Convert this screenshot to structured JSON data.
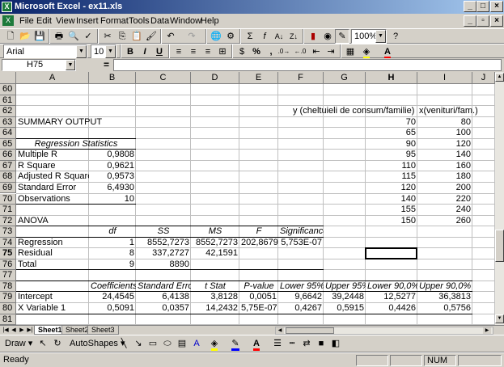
{
  "window": {
    "title": "Microsoft Excel - ex11.xls",
    "app_icon": "X",
    "min_btn": "_",
    "max_btn": "□",
    "close_btn": "×"
  },
  "menu": {
    "items": [
      "File",
      "Edit",
      "View",
      "Insert",
      "Format",
      "Tools",
      "Data",
      "Window",
      "Help"
    ],
    "doc_min": "_",
    "doc_restore": "▫",
    "doc_close": "×"
  },
  "toolbar_standard": {
    "zoom": "100%"
  },
  "toolbar_format": {
    "font": "Arial",
    "size": "10",
    "bold": "B",
    "italic": "I",
    "underline": "U",
    "percent": "%",
    "comma": ","
  },
  "formula_bar": {
    "name_box": "H75",
    "equals": "=",
    "content": ""
  },
  "columns": [
    "A",
    "B",
    "C",
    "D",
    "E",
    "F",
    "G",
    "H",
    "I",
    "J"
  ],
  "active_column": "H",
  "rows": [
    "60",
    "61",
    "62",
    "63",
    "64",
    "65",
    "66",
    "67",
    "68",
    "69",
    "70",
    "71",
    "72",
    "73",
    "74",
    "75",
    "76",
    "77",
    "78",
    "79",
    "80",
    "81"
  ],
  "active_row": "75",
  "cells": {
    "F62": "y (cheltuieli de consum/familie)",
    "I62": "x(venituri/fam.)",
    "A63": "SUMMARY OUTPUT",
    "B65": "Regression Statistics",
    "A66": "Multiple R",
    "B66": "0,9808",
    "A67": "R Square",
    "B67": "0,9621",
    "A68": "Adjusted R Square",
    "B68": "0,9573",
    "A69": "Standard Error",
    "B69": "6,4930",
    "A70": "Observations",
    "B70": "10",
    "A72": "ANOVA",
    "B73": "df",
    "C73": "SS",
    "D73": "MS",
    "E73": "F",
    "F73": "Significance F",
    "A74": "Regression",
    "B74": "1",
    "C74": "8552,7273",
    "D74": "8552,7273",
    "E74": "202,8679",
    "F74": "5,753E-07",
    "A75": "Residual",
    "B75": "8",
    "C75": "337,2727",
    "D75": "42,1591",
    "A76": "Total",
    "B76": "9",
    "C76": "8890",
    "B78": "Coefficients",
    "C78": "Standard Error",
    "D78": "t Stat",
    "E78": "P-value",
    "F78": "Lower 95%",
    "G78": "Upper 95%",
    "H78": "Lower 90,0%",
    "I78": "Upper 90,0%",
    "A79": "Intercept",
    "B79": "24,4545",
    "C79": "6,4138",
    "D79": "3,8128",
    "E79": "0,0051",
    "F79": "9,6642",
    "G79": "39,2448",
    "H79": "12,5277",
    "I79": "36,3813",
    "A80": "X Variable 1",
    "B80": "0,5091",
    "C80": "0,0357",
    "D80": "14,2432",
    "E80": "5,75E-07",
    "F80": "0,4267",
    "G80": "0,5915",
    "H80": "0,4426",
    "I80": "0,5756"
  },
  "data_table": {
    "y": [
      "70",
      "65",
      "90",
      "95",
      "110",
      "115",
      "120",
      "140",
      "155",
      "150"
    ],
    "x": [
      "80",
      "100",
      "120",
      "140",
      "160",
      "180",
      "200",
      "220",
      "240",
      "260"
    ]
  },
  "sheet_tabs": [
    "Sheet1",
    "Sheet2",
    "Sheet3"
  ],
  "active_tab": "Sheet1",
  "drawing": {
    "draw_label": "Draw ▾",
    "autoshapes_label": "AutoShapes ▾"
  },
  "status": {
    "ready": "Ready",
    "num": "NUM"
  },
  "colors": {
    "title_start": "#0a246a",
    "title_end": "#a6caf0",
    "chrome": "#d4d0c8"
  }
}
